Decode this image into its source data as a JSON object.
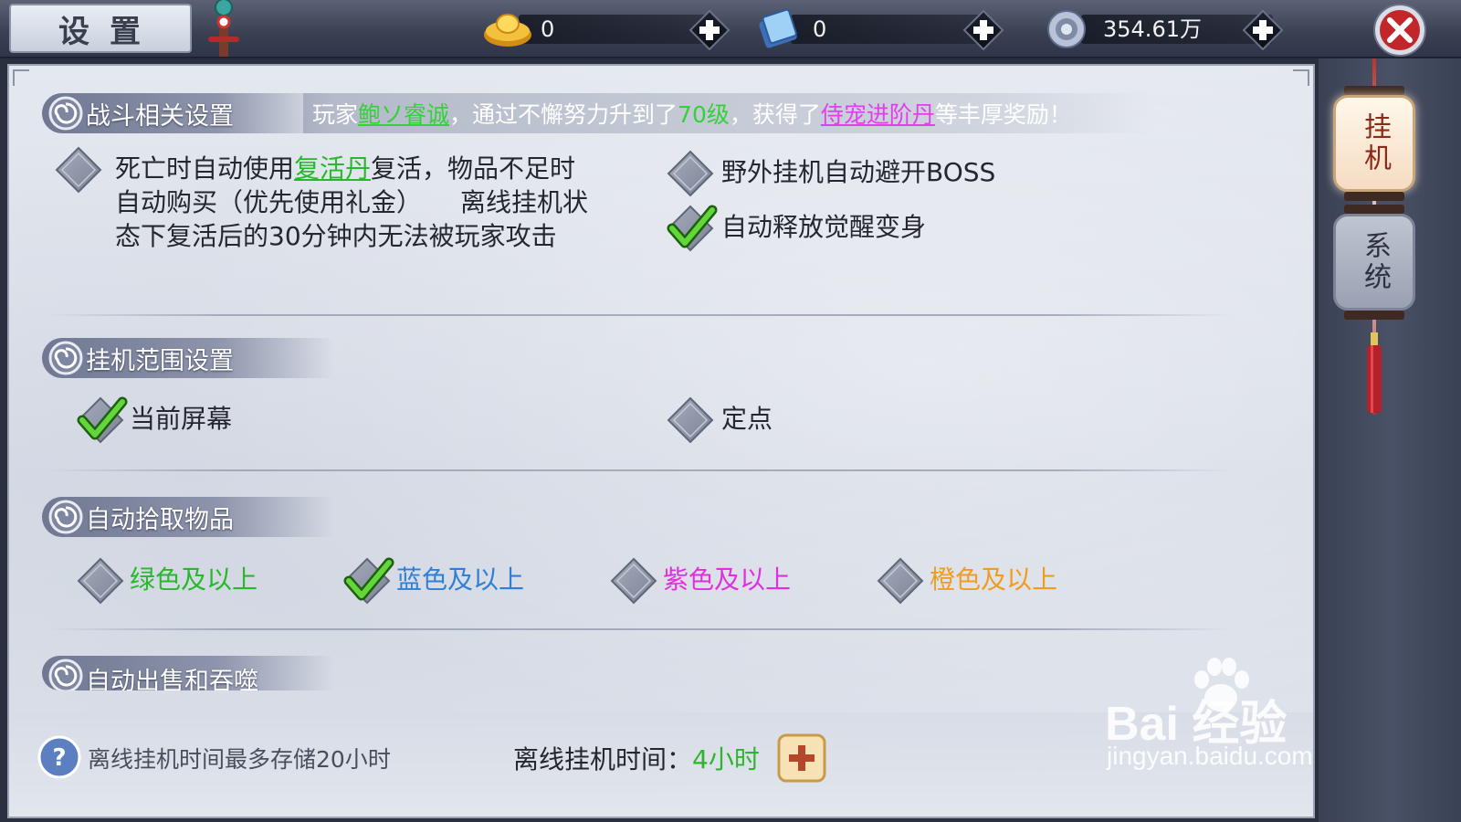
{
  "window": {
    "title": "设置",
    "close_icon": "close-icon"
  },
  "currencies": [
    {
      "icon": "gold-ingot-icon",
      "value": "0"
    },
    {
      "icon": "scroll-coupon-icon",
      "value": "0"
    },
    {
      "icon": "silver-coin-icon",
      "value": "354.61万"
    }
  ],
  "broadcast": {
    "prefix": "玩家",
    "player": "鲍ソ睿诚",
    "middle": "，通过不懈努力升到了",
    "level": "70级",
    "middle2": "，获得了",
    "item": "侍宠进阶丹",
    "suffix": "等丰厚奖励！"
  },
  "sections": {
    "combat": {
      "title": "战斗相关设置",
      "revive": {
        "text_before": "死亡时自动使用",
        "item": "复活丹",
        "text_after": "复活，物品不足时自动购买（优先使用礼金）　　离线挂机状态下复活后的30分钟内无法被玩家攻击",
        "checked": false
      },
      "avoid_boss": {
        "label": "野外挂机自动避开BOSS",
        "checked": false
      },
      "auto_awaken": {
        "label": "自动释放觉醒变身",
        "checked": true
      }
    },
    "range": {
      "title": "挂机范围设置",
      "current_screen": {
        "label": "当前屏幕",
        "checked": true
      },
      "fixed_point": {
        "label": "定点",
        "checked": false
      }
    },
    "pickup": {
      "title": "自动拾取物品",
      "options": [
        {
          "label": "绿色及以上",
          "color": "#27b82b",
          "checked": false
        },
        {
          "label": "蓝色及以上",
          "color": "#2f7fd6",
          "checked": true
        },
        {
          "label": "紫色及以上",
          "color": "#e02fe0",
          "checked": false
        },
        {
          "label": "橙色及以上",
          "color": "#f29c1f",
          "checked": false
        }
      ]
    },
    "sell": {
      "title": "自动出售和吞噬"
    }
  },
  "footer": {
    "help_text": "离线挂机时间最多存储20小时",
    "offline_label": "离线挂机时间：",
    "offline_value": "4小时"
  },
  "tabs": [
    {
      "label": "挂机",
      "active": true
    },
    {
      "label": "系统",
      "active": false
    }
  ],
  "watermark": {
    "brand": "Bai 经验",
    "url": "jingyan.baidu.com"
  }
}
